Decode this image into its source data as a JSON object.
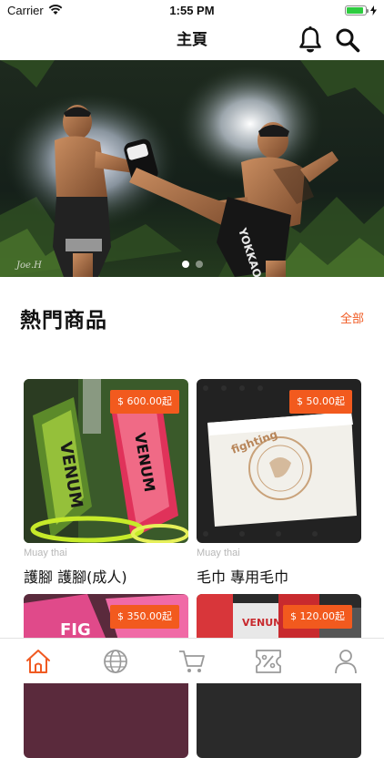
{
  "status_bar": {
    "carrier": "Carrier",
    "time": "1:55 PM"
  },
  "nav": {
    "title": "主頁",
    "icons": [
      "bell-icon",
      "search-icon"
    ]
  },
  "banner": {
    "photo_caption": "Joe.H",
    "slides": 2,
    "active_slide": 1
  },
  "section": {
    "title": "熱門商品",
    "see_all": "全部"
  },
  "products": [
    {
      "price": "$ 600.00起",
      "category": "Muay thai",
      "name": "護腳 護腳(成人)"
    },
    {
      "price": "$ 50.00起",
      "category": "Muay thai",
      "name": "毛巾 專用毛巾"
    },
    {
      "price": "$ 350.00起",
      "category": "",
      "name": ""
    },
    {
      "price": "$ 120.00起",
      "category": "",
      "name": ""
    }
  ],
  "tab_bar": {
    "tabs": [
      {
        "icon": "home-icon",
        "active": true
      },
      {
        "icon": "globe-icon",
        "active": false
      },
      {
        "icon": "cart-icon",
        "active": false
      },
      {
        "icon": "coupon-icon",
        "active": false
      },
      {
        "icon": "profile-icon",
        "active": false
      }
    ],
    "active_color": "#f05a22",
    "inactive_color": "#9a9a9a"
  },
  "colors": {
    "accent": "#f25a1e"
  }
}
